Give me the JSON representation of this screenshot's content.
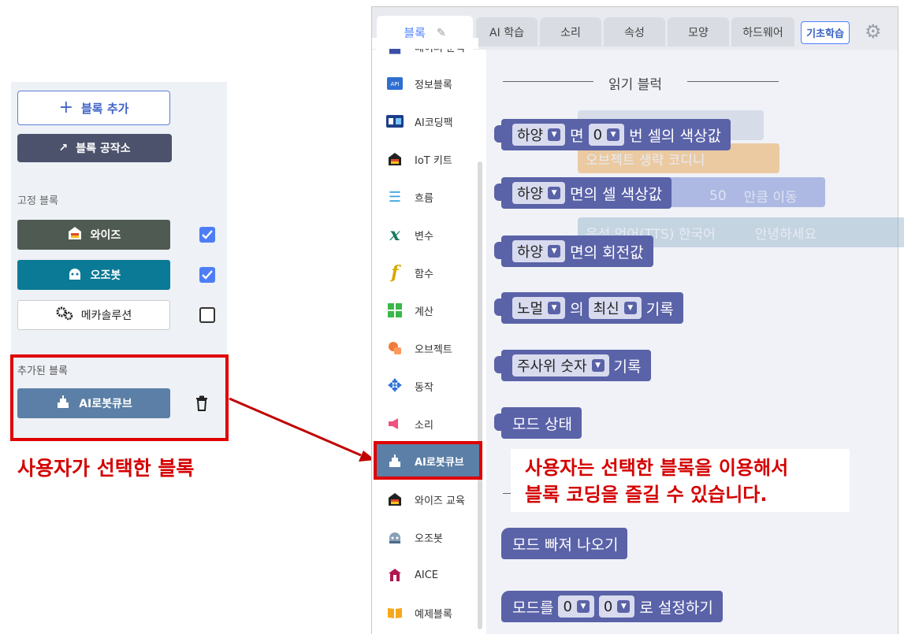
{
  "left_panel": {
    "add_block_label": "블록 추가",
    "block_factory_label": "블록 공작소",
    "fixed_blocks_title": "고정 블록",
    "fixed_blocks": [
      {
        "label": "와이즈",
        "checked": true,
        "color": "#4f5a52"
      },
      {
        "label": "오조봇",
        "checked": true,
        "color": "#0b7a96"
      },
      {
        "label": "메카솔루션",
        "checked": false,
        "color": "#ffffff"
      }
    ],
    "added_blocks_title": "추가된 블록",
    "added_blocks": [
      {
        "label": "AI로봇큐브",
        "color": "#5b7fa6"
      }
    ],
    "annotation": "사용자가 선택한 블록"
  },
  "tabs": [
    {
      "label": "블록",
      "active": true
    },
    {
      "label": "AI 학습",
      "active": false
    },
    {
      "label": "소리",
      "active": false
    },
    {
      "label": "속성",
      "active": false
    },
    {
      "label": "모양",
      "active": false
    },
    {
      "label": "하드웨어",
      "active": false
    }
  ],
  "basic_learning_label": "기초학습",
  "categories": [
    {
      "label": "데이터 분석",
      "icon": "data-analysis-icon"
    },
    {
      "label": "정보블록",
      "icon": "api-icon"
    },
    {
      "label": "AI코딩팩",
      "icon": "ai-coding-pack-icon"
    },
    {
      "label": "IoT 키트",
      "icon": "iot-kit-icon"
    },
    {
      "label": "흐름",
      "icon": "flow-icon"
    },
    {
      "label": "변수",
      "icon": "variable-icon"
    },
    {
      "label": "함수",
      "icon": "function-icon"
    },
    {
      "label": "계산",
      "icon": "calculator-icon"
    },
    {
      "label": "오브젝트",
      "icon": "object-icon"
    },
    {
      "label": "동작",
      "icon": "move-icon"
    },
    {
      "label": "소리",
      "icon": "sound-icon"
    },
    {
      "label": "AI로봇큐브",
      "icon": "robot-cube-icon",
      "selected": true
    },
    {
      "label": "와이즈 교육",
      "icon": "wise-icon"
    },
    {
      "label": "오조봇",
      "icon": "ozobot-icon"
    },
    {
      "label": "AICE",
      "icon": "aice-icon"
    },
    {
      "label": "예제블록",
      "icon": "example-icon"
    }
  ],
  "canvas": {
    "section_header": "읽기 블럭",
    "blocks": {
      "b1": {
        "dd1": "하양",
        "t1": "면",
        "dd2": "0",
        "t2": "번 셀의 색상값"
      },
      "b2": {
        "dd1": "하양",
        "t1": "면의 셀 색상값"
      },
      "b3": {
        "dd1": "하양",
        "t1": "면의 회전값"
      },
      "b4": {
        "dd1": "노멀",
        "t1": "의",
        "dd2": "최신",
        "t2": "기록"
      },
      "b5": {
        "dd1": "주사위 숫자",
        "t1": "기록"
      },
      "b6": {
        "t1": "모드 상태"
      },
      "b7": {
        "t1": "모드 빠져 나오기"
      },
      "b8": {
        "t1": "모드를",
        "dd1": "0",
        "dd2": "0",
        "t2": "로 설정하기"
      }
    },
    "ghosts": {
      "g1": "오브젝트 생략 코디니",
      "g2": "50",
      "g3": "만큼 이동",
      "g4": "음성 언어(TTS) 한국어",
      "g5": "안녕하세요"
    },
    "callout": [
      "사용자는 선택한 블록을 이용해서",
      "블록 코딩을 즐길 수 있습니다."
    ]
  },
  "colors": {
    "accent": "#4f80ff",
    "block": "#5a62a8",
    "highlight": "#e00000",
    "selected_category": "#5b7fa6"
  }
}
